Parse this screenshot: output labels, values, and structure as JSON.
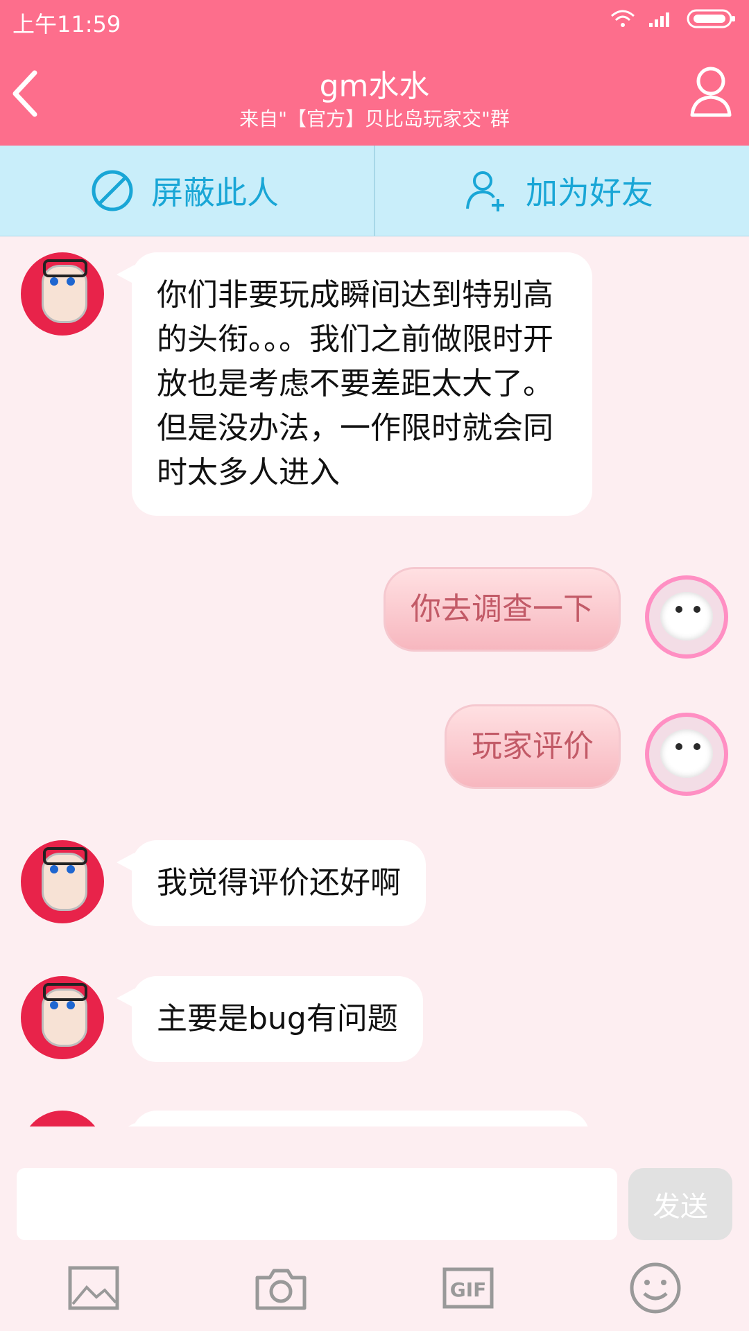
{
  "status_bar": {
    "time": "上午11:59"
  },
  "header": {
    "title": "gm水水",
    "subtitle": "来自\"【官方】贝比岛玩家交\"群"
  },
  "actions": {
    "block": "屏蔽此人",
    "add_friend": "加为好友"
  },
  "messages": [
    {
      "side": "left",
      "text": "你们非要玩成瞬间达到特别高的头衔。。。我们之前做限时开放也是考虑不要差距太大了。但是没办法，一作限时就会同时太多人进入"
    },
    {
      "side": "right",
      "text": "你去调查一下"
    },
    {
      "side": "right",
      "text": "玩家评价"
    },
    {
      "side": "left",
      "text": "我觉得评价还好啊"
    },
    {
      "side": "left",
      "text": "主要是bug有问题"
    }
  ],
  "input": {
    "placeholder": "",
    "send_label": "发送"
  },
  "toolbar": {
    "gif_label": "GIF"
  },
  "colors": {
    "header": "#fd6e8c",
    "action_bg": "#c9eefa",
    "action_text": "#19a6d6",
    "chat_bg": "#fdeef1"
  }
}
